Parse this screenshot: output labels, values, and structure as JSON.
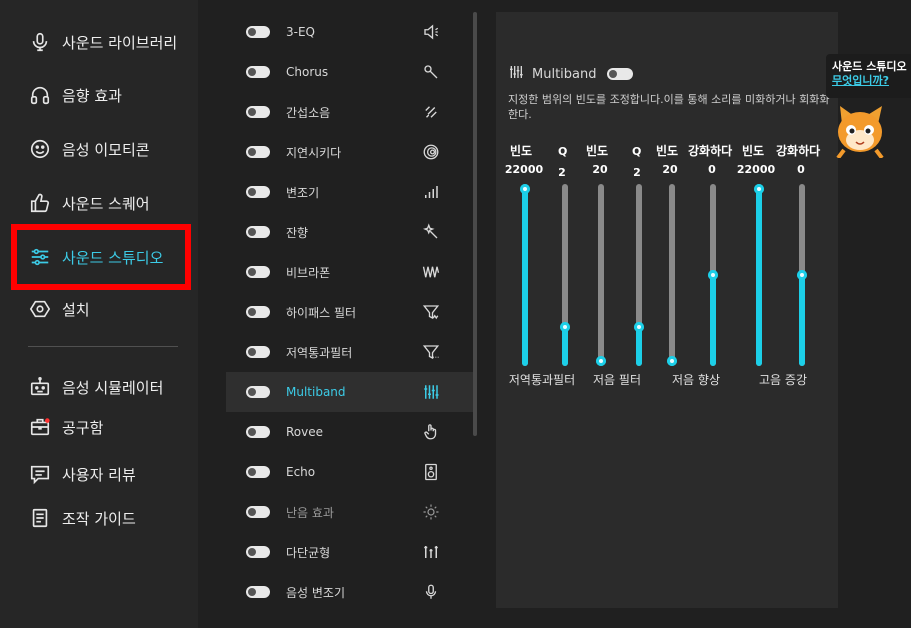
{
  "sidebar": {
    "items": [
      {
        "label": "사운드 라이브러리",
        "icon": "microphone-icon"
      },
      {
        "label": "음향 효과",
        "icon": "headphones-icon"
      },
      {
        "label": "음성 이모티콘",
        "icon": "smiley-icon"
      },
      {
        "label": "사운드 스퀘어",
        "icon": "thumbs-up-icon"
      },
      {
        "label": "사운드 스튜디오",
        "icon": "sliders-icon",
        "active": true
      },
      {
        "label": "설치",
        "icon": "hexagon-settings-icon"
      },
      {
        "label": "음성 시뮬레이터",
        "icon": "robot-icon"
      },
      {
        "label": "공구함",
        "icon": "toolbox-icon"
      },
      {
        "label": "사용자 리뷰",
        "icon": "comment-icon"
      },
      {
        "label": "조작 가이드",
        "icon": "document-icon"
      }
    ]
  },
  "effects": [
    {
      "name": "3-EQ",
      "icon": "speaker-icon"
    },
    {
      "name": "Chorus",
      "icon": "wand-icon"
    },
    {
      "name": "간섭소음",
      "icon": "noise-icon"
    },
    {
      "name": "지연시키다",
      "icon": "spiral-icon"
    },
    {
      "name": "변조기",
      "icon": "bars-icon"
    },
    {
      "name": "잔향",
      "icon": "magic-star-icon"
    },
    {
      "name": "비브라폰",
      "icon": "vibrato-icon"
    },
    {
      "name": "하이패스 필터",
      "icon": "highpass-filter-icon"
    },
    {
      "name": "저역통과필터",
      "icon": "lowpass-filter-icon"
    },
    {
      "name": "Multiband",
      "icon": "equalizer-icon",
      "active": true
    },
    {
      "name": "Rovee",
      "icon": "hand-pointer-icon"
    },
    {
      "name": "Echo",
      "icon": "speaker-box-icon"
    },
    {
      "name": "난음 효과",
      "icon": "sun-icon",
      "dim": true
    },
    {
      "name": "다단균형",
      "icon": "multi-sliders-icon"
    },
    {
      "name": "음성 변조기",
      "icon": "mic-small-icon"
    }
  ],
  "panel": {
    "title": "Multiband",
    "description": "지정한 범위의 빈도를 조정합니다.이를 통해 소리를 미화하거나 회화화한다.",
    "column_labels": [
      "빈도",
      "Q",
      "빈도",
      "Q",
      "빈도",
      "강화하다",
      "빈도",
      "강화하다"
    ],
    "sliders": [
      {
        "value": "22000",
        "level": 1.0
      },
      {
        "value": "2",
        "level": 0.2
      },
      {
        "value": "20",
        "level": 0.0
      },
      {
        "value": "2",
        "level": 0.2
      },
      {
        "value": "20",
        "level": 0.0
      },
      {
        "value": "0",
        "level": 0.5
      },
      {
        "value": "22000",
        "level": 1.0
      },
      {
        "value": "0",
        "level": 0.5
      }
    ],
    "band_labels": [
      "저역통과필터",
      "저음 필터",
      "저음 향상",
      "고음 증강"
    ]
  },
  "tooltip": {
    "line1": "사운드 스튜디오",
    "line2": "무엇입니까?"
  },
  "colors": {
    "accent": "#1ccfe8",
    "highlight_frame": "#ff0000"
  }
}
